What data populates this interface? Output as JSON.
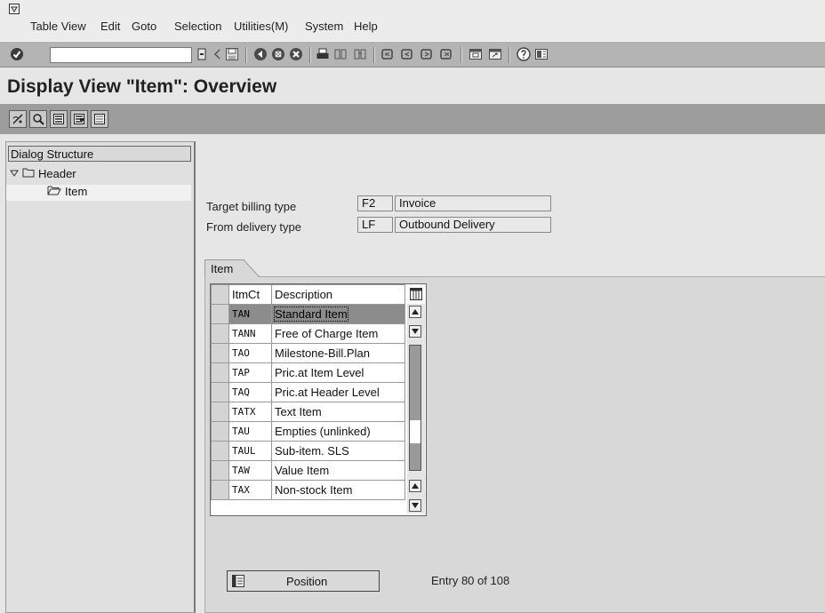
{
  "menu": {
    "items": [
      {
        "label": "Table View"
      },
      {
        "label": "Edit"
      },
      {
        "label": "Goto"
      },
      {
        "label": "Selection"
      },
      {
        "label": "Utilities(M)"
      },
      {
        "label": "System"
      },
      {
        "label": "Help"
      }
    ]
  },
  "toolbar": {
    "command_field_value": "",
    "icons": [
      "enter-icon",
      "back-arrow-icon",
      "save-icon",
      "back-icon",
      "exit-icon",
      "cancel-icon",
      "print-icon",
      "find-icon",
      "find-next-icon",
      "first-page-icon",
      "previous-page-icon",
      "next-page-icon",
      "last-page-icon",
      "create-session-icon",
      "shortcut-icon",
      "help-icon",
      "layout-icon"
    ]
  },
  "page": {
    "title": "Display View \"Item\": Overview"
  },
  "app_toolbar": {
    "icons": [
      "change-display-icon",
      "details-icon",
      "select-all-icon",
      "select-block-icon",
      "deselect-all-icon"
    ]
  },
  "dialog_structure": {
    "title": "Dialog Structure",
    "nodes": [
      {
        "label": "Header",
        "level": 0,
        "expanded": true
      },
      {
        "label": "Item",
        "level": 1,
        "selected": true
      }
    ]
  },
  "header_fields": {
    "target_billing_type": {
      "label": "Target billing type",
      "code": "F2",
      "text": "Invoice"
    },
    "from_delivery_type": {
      "label": "From delivery type",
      "code": "LF",
      "text": "Outbound Delivery"
    }
  },
  "item_tab": {
    "label": "Item"
  },
  "table": {
    "columns": [
      "ItmCt",
      "Description"
    ],
    "rows": [
      {
        "code": "TAN",
        "description": "Standard Item",
        "selected": true
      },
      {
        "code": "TANN",
        "description": "Free of Charge Item"
      },
      {
        "code": "TAO",
        "description": "Milestone-Bill.Plan"
      },
      {
        "code": "TAP",
        "description": "Pric.at Item Level"
      },
      {
        "code": "TAQ",
        "description": "Pric.at Header Level"
      },
      {
        "code": "TATX",
        "description": "Text Item"
      },
      {
        "code": "TAU",
        "description": "Empties (unlinked)"
      },
      {
        "code": "TAUL",
        "description": "Sub-item. SLS"
      },
      {
        "code": "TAW",
        "description": "Value Item"
      },
      {
        "code": "TAX",
        "description": "Non-stock Item"
      }
    ],
    "scroll_position": 0.74
  },
  "footer": {
    "position_button": "Position",
    "entry_text": "Entry 80 of 108"
  },
  "colors": {
    "toolbar_bg": "#b4b4b4",
    "app_toolbar_bg": "#9d9d9d",
    "selected_row": "#8c8c8c"
  }
}
